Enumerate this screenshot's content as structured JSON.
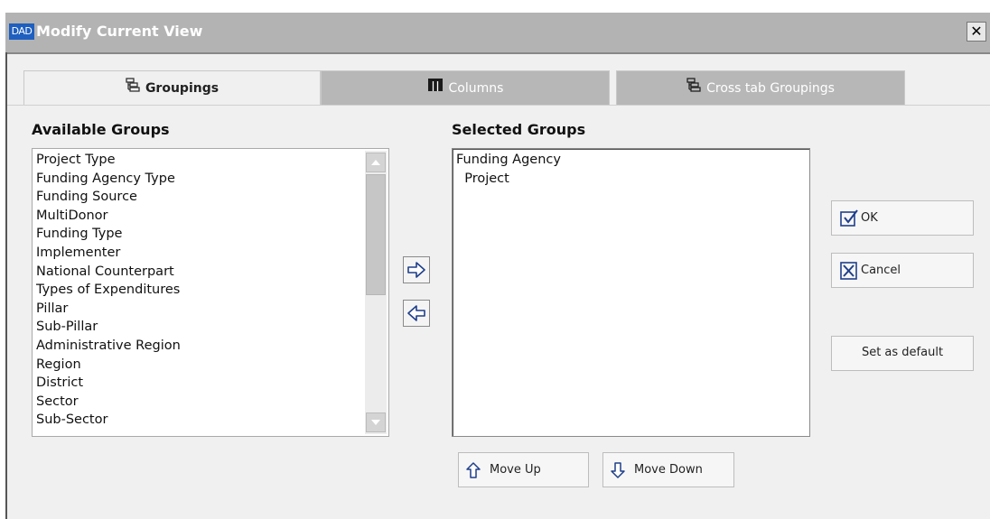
{
  "window": {
    "logo_text": "DAD",
    "title": "Modify Current View",
    "close_glyph": "✕"
  },
  "tabs": [
    {
      "label": "Groupings",
      "icon": "tree-icon",
      "active": true
    },
    {
      "label": "Columns",
      "icon": "columns-icon",
      "active": false
    },
    {
      "label": "Cross tab Groupings",
      "icon": "tree-icon",
      "active": false
    }
  ],
  "available": {
    "title": "Available Groups",
    "items": [
      "Project Type",
      "Funding Agency Type",
      "Funding Source",
      "MultiDonor",
      "Funding Type",
      "Implementer",
      "National Counterpart",
      "Types of Expenditures",
      "Pillar",
      "Sub-Pillar",
      "Administrative Region",
      "Region",
      "District",
      "Sector",
      "Sub-Sector"
    ]
  },
  "selected": {
    "title": "Selected Groups",
    "items": [
      "Funding Agency",
      "  Project"
    ]
  },
  "buttons": {
    "ok": "OK",
    "cancel": "Cancel",
    "set_default": "Set as default",
    "move_up": "Move Up",
    "move_down": "Move Down"
  },
  "colors": {
    "titlebar": "#b3b3b3",
    "accent_icon": "#1f3f8a"
  }
}
